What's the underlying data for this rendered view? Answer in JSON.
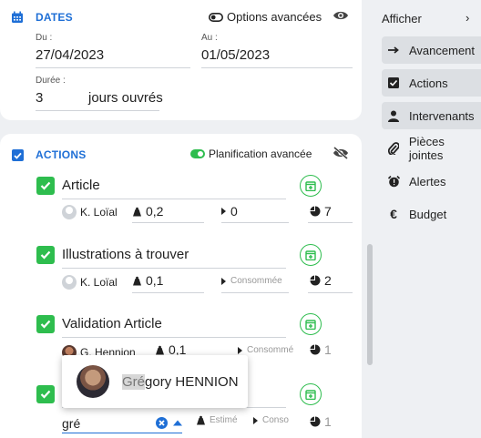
{
  "dates": {
    "title": "DATES",
    "options_label": "Options avancées",
    "du_label": "Du :",
    "du_value": "27/04/2023",
    "au_label": "Au :",
    "au_value": "01/05/2023",
    "duree_label": "Durée :",
    "duree_value": "3",
    "duree_unit": "jours ouvrés"
  },
  "actions": {
    "title": "ACTIONS",
    "planning_label": "Planification avancée",
    "tasks": [
      {
        "title": "Article",
        "person": "K. Loïal",
        "weight": "0,2",
        "consumed": "0",
        "estimate": "7"
      },
      {
        "title": "Illustrations à trouver",
        "person": "K. Loïal",
        "weight": "0,1",
        "consumed_placeholder": "Consommée",
        "estimate": "2"
      },
      {
        "title": "Validation Article",
        "person": "G. Hennion",
        "weight": "0,1",
        "consumed_placeholder": "Consommé",
        "estimate": "1"
      },
      {
        "title": "",
        "search_value": "gré",
        "weight_placeholder": "Estimé",
        "consumed_placeholder": "Conso",
        "estimate": "1"
      }
    ]
  },
  "popup": {
    "name_match": "Gré",
    "name_rest": "gory HENNION"
  },
  "sidebar": {
    "afficher_label": "Afficher",
    "items": [
      {
        "label": "Avancement",
        "icon": "arrow-right-icon"
      },
      {
        "label": "Actions",
        "icon": "checkbox-icon"
      },
      {
        "label": "Intervenants",
        "icon": "person-icon"
      },
      {
        "label": "Pièces jointes",
        "icon": "paperclip-icon"
      },
      {
        "label": "Alertes",
        "icon": "alarm-icon"
      },
      {
        "label": "Budget",
        "icon": "euro-icon"
      }
    ]
  },
  "colors": {
    "accent_blue": "#1f6fd6",
    "accent_green": "#2ebd4e",
    "background": "#eef0f3"
  }
}
